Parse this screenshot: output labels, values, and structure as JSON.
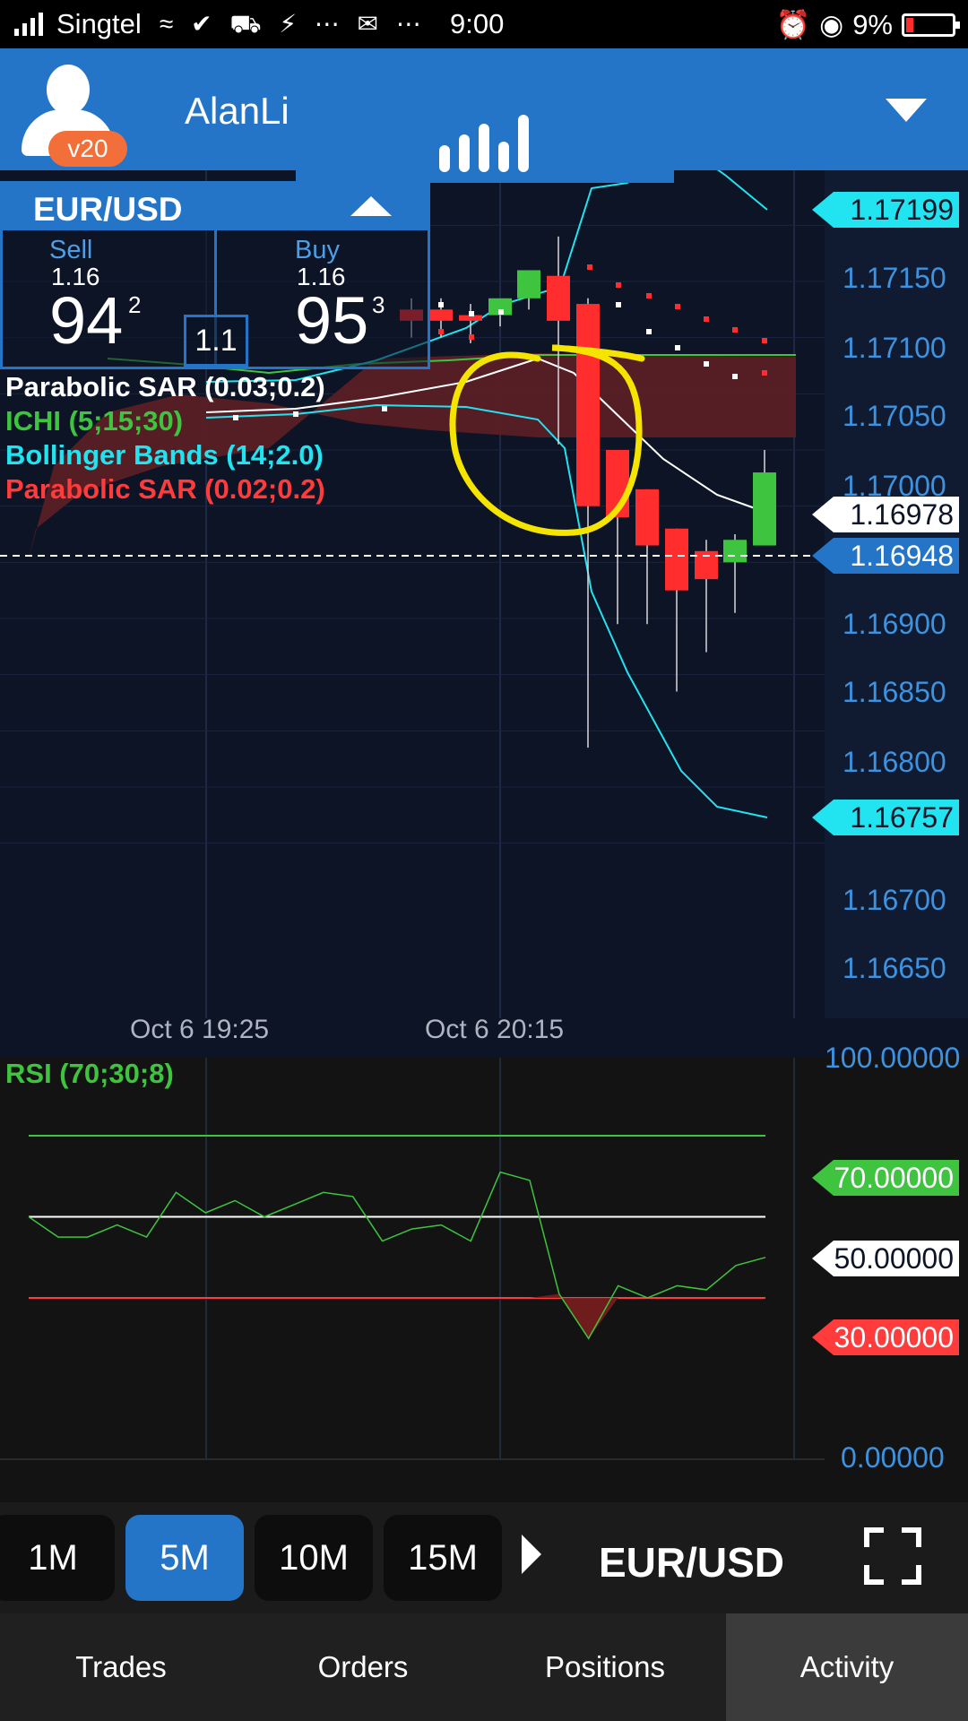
{
  "status_bar": {
    "carrier": "Singtel",
    "time": "9:00",
    "battery": "9%",
    "icons": [
      "signal-icon",
      "wifi-icon",
      "check-icon",
      "car-icon",
      "shield-icon",
      "mail-icon",
      "more-icon",
      "alarm-icon",
      "eye-icon",
      "battery-icon"
    ]
  },
  "header": {
    "username": "AlanLi",
    "level_badge": "v20"
  },
  "price_panel": {
    "symbol": "EUR/USD",
    "sell": {
      "label": "Sell",
      "big_figure": "1.16",
      "pips": "94",
      "fraction": "2"
    },
    "buy": {
      "label": "Buy",
      "big_figure": "1.16",
      "pips": "95",
      "fraction": "3"
    },
    "spread": "1.1"
  },
  "indicators": [
    {
      "label": "Parabolic SAR (0.03;0.2)",
      "color": "#ffffff"
    },
    {
      "label": "ICHI (5;15;30)",
      "color": "#3ec43e"
    },
    {
      "label": "Bollinger Bands (14;2.0)",
      "color": "#22e3f0"
    },
    {
      "label": "Parabolic SAR (0.02;0.2)",
      "color": "#ff3b3b"
    }
  ],
  "price_axis": {
    "ticks": [
      "1.17150",
      "1.17100",
      "1.17050",
      "1.17000",
      "1.16900",
      "1.16850",
      "1.16800",
      "1.16700",
      "1.16650"
    ],
    "tags": [
      {
        "value": "1.17199",
        "bg": "#22e3f0",
        "fg": "#0c1426"
      },
      {
        "value": "1.16978",
        "bg": "#ffffff",
        "fg": "#0c1426"
      },
      {
        "value": "1.16948",
        "bg": "#2475c8",
        "fg": "#ffffff"
      },
      {
        "value": "1.16757",
        "bg": "#22e3f0",
        "fg": "#0c1426"
      }
    ]
  },
  "time_axis": [
    "Oct 6 19:25",
    "Oct 6 20:15"
  ],
  "chart_data": {
    "type": "candlestick",
    "symbol": "EUR/USD",
    "candles": [
      {
        "o": 1.17075,
        "h": 1.17085,
        "l": 1.1705,
        "c": 1.17065
      },
      {
        "o": 1.17075,
        "h": 1.17085,
        "l": 1.1705,
        "c": 1.17065
      },
      {
        "o": 1.1707,
        "h": 1.1708,
        "l": 1.17045,
        "c": 1.17065
      },
      {
        "o": 1.1707,
        "h": 1.1708,
        "l": 1.1706,
        "c": 1.17085
      },
      {
        "o": 1.17085,
        "h": 1.1711,
        "l": 1.17075,
        "c": 1.1711
      },
      {
        "o": 1.17105,
        "h": 1.1714,
        "l": 1.16955,
        "c": 1.17065
      },
      {
        "o": 1.1708,
        "h": 1.17085,
        "l": 1.16685,
        "c": 1.169
      },
      {
        "o": 1.1695,
        "h": 1.1695,
        "l": 1.16795,
        "c": 1.1689
      },
      {
        "o": 1.16915,
        "h": 1.16915,
        "l": 1.16795,
        "c": 1.16865
      },
      {
        "o": 1.1688,
        "h": 1.1688,
        "l": 1.16735,
        "c": 1.16825
      },
      {
        "o": 1.1686,
        "h": 1.1687,
        "l": 1.1677,
        "c": 1.16835
      },
      {
        "o": 1.1685,
        "h": 1.16875,
        "l": 1.16805,
        "c": 1.1687
      },
      {
        "o": 1.16865,
        "h": 1.1695,
        "l": 1.16865,
        "c": 1.1693
      }
    ],
    "ylim": [
      1.16625,
      1.17225
    ],
    "rsi": {
      "label": "RSI (70;30;8)",
      "levels": [
        70,
        50,
        30
      ],
      "ylim": [
        0,
        100
      ],
      "values": [
        50,
        45,
        45,
        48,
        45,
        56,
        51,
        54,
        50,
        53,
        56,
        55,
        44,
        47,
        48,
        44,
        61,
        59,
        31,
        20,
        33,
        30,
        33,
        32,
        38,
        40
      ]
    }
  },
  "rsi_axis": {
    "top": "100.00000",
    "bottom": "0.00000",
    "tags": [
      {
        "value": "70.00000",
        "bg": "#3ec43e",
        "fg": "#ffffff"
      },
      {
        "value": "50.00000",
        "bg": "#ffffff",
        "fg": "#0c1426"
      },
      {
        "value": "30.00000",
        "bg": "#ff3b3b",
        "fg": "#ffffff"
      }
    ]
  },
  "timeframes": {
    "items": [
      "1M",
      "5M",
      "10M",
      "15M"
    ],
    "active": "5M",
    "symbol": "EUR/USD"
  },
  "bottom_nav": {
    "items": [
      "Trades",
      "Orders",
      "Positions",
      "Activity"
    ],
    "active": "Activity"
  }
}
